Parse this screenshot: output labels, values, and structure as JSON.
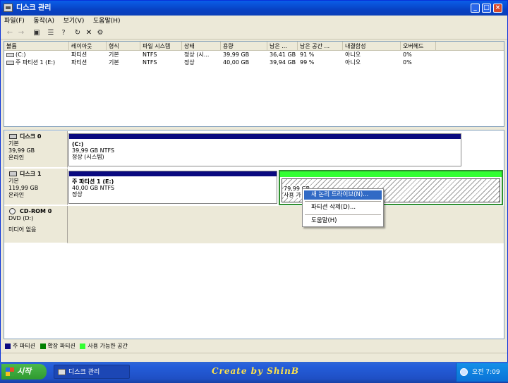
{
  "window": {
    "title": "디스크 관리",
    "buttons": {
      "minimize": "_",
      "maximize": "□",
      "close": "×"
    }
  },
  "menu": [
    "파일(F)",
    "동작(A)",
    "보기(V)",
    "도움말(H)"
  ],
  "toolbar_icons": [
    "back-arrow-icon",
    "forward-arrow-icon",
    "console-icon",
    "properties-icon",
    "help-icon",
    "refresh-icon",
    "delete-icon",
    "settings-icon"
  ],
  "volume_list": {
    "columns": [
      "볼륨",
      "레이아웃",
      "형식",
      "파일 시스템",
      "상태",
      "용량",
      "남은 ...",
      "남은 공간 ...",
      "내결함성",
      "오버헤드"
    ],
    "rows": [
      [
        "(C:)",
        "파티션",
        "기본",
        "NTFS",
        "정상 (시...",
        "39,99 GB",
        "36,41 GB",
        "91 %",
        "아니오",
        "0%"
      ],
      [
        "주 파티션 1 (E:)",
        "파티션",
        "기본",
        "NTFS",
        "정상",
        "40,00 GB",
        "39,94 GB",
        "99 %",
        "아니오",
        "0%"
      ]
    ]
  },
  "disks": [
    {
      "name": "디스크 0",
      "type": "기본",
      "size": "39,99 GB",
      "status": "온라인",
      "partitions": [
        {
          "label": "(C:)",
          "info": "39,99 GB NTFS",
          "state": "정상 (시스템)"
        }
      ]
    },
    {
      "name": "디스크 1",
      "type": "기본",
      "size": "119,99 GB",
      "status": "온라인",
      "partitions": [
        {
          "label": "주 파티션 1 (E:)",
          "info": "40,00 GB NTFS",
          "state": "정상"
        },
        {
          "info": "79,99 GB",
          "state": "사용 가"
        }
      ]
    },
    {
      "name": "CD-ROM 0",
      "type": "DVD (D:)",
      "status": "미디어 없음"
    }
  ],
  "context_menu": [
    "새 논리 드라이브(N)...",
    "파티션 삭제(D)...",
    "도움말(H)"
  ],
  "legend": [
    {
      "label": "주 파티션",
      "color": "#0a0a80"
    },
    {
      "label": "확장 파티션",
      "color": "#008000"
    },
    {
      "label": "사용 가능한 공간",
      "color": "#33ff33"
    }
  ],
  "taskbar": {
    "start": "시작",
    "task": "디스크 관리",
    "brand": "Create by ShinB",
    "clock": "오전 7:09"
  }
}
